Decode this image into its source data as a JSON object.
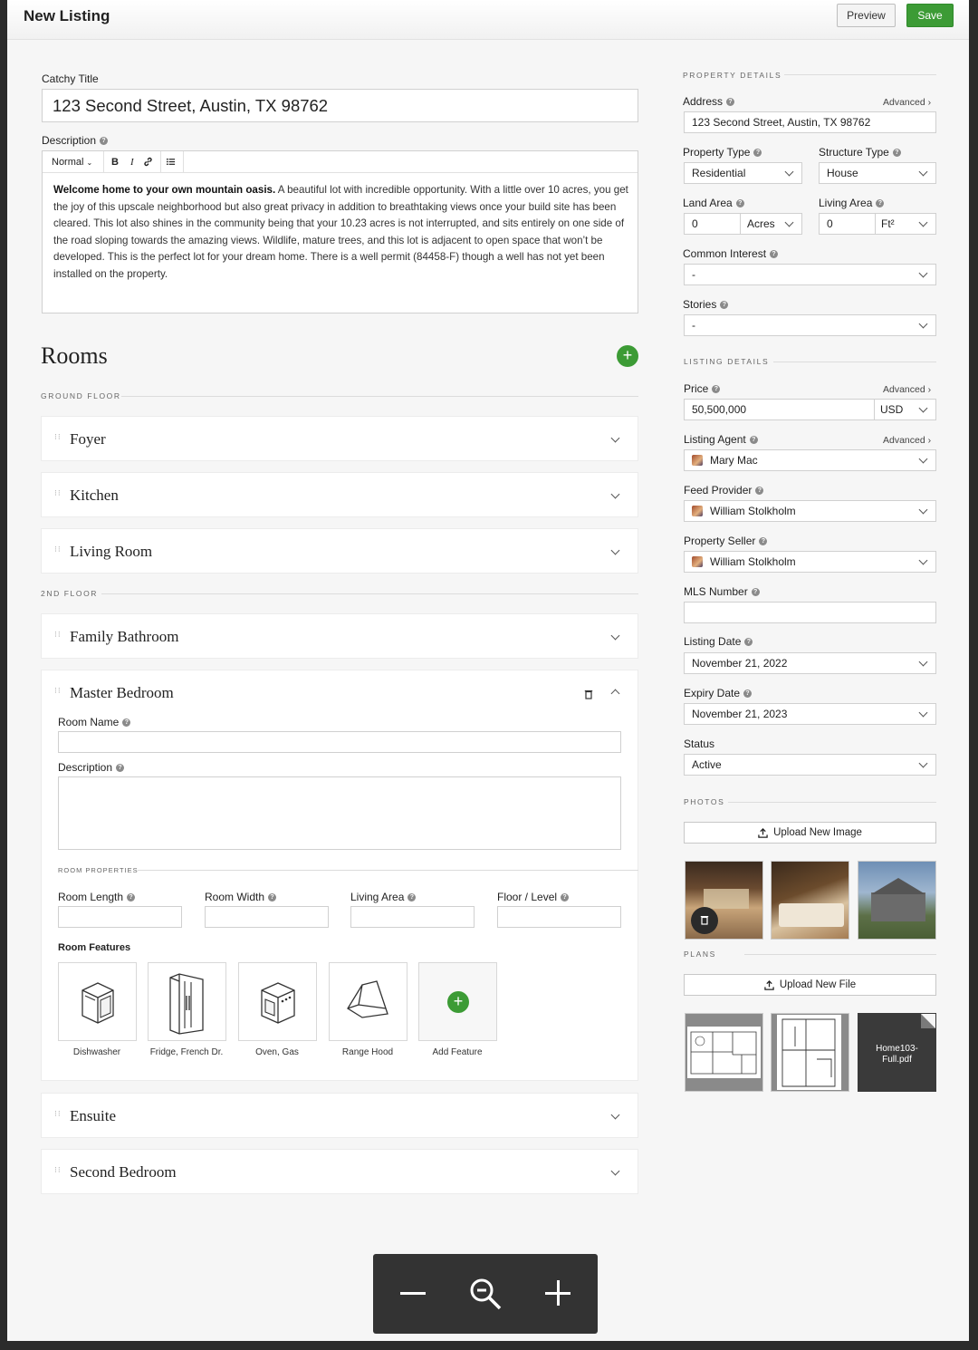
{
  "header": {
    "title": "New Listing",
    "preview_label": "Preview",
    "save_label": "Save"
  },
  "form": {
    "title_label": "Catchy Title",
    "title_value": "123 Second Street, Austin, TX 98762",
    "description_label": "Description",
    "toolbar": {
      "format": "Normal",
      "bold": "B",
      "italic": "I"
    },
    "description_bold": "Welcome home to your own mountain oasis.",
    "description_body": " A beautiful lot with incredible opportunity.   With a little over 10 acres, you get the joy of this upscale neighborhood but also great privacy in addition to breathtaking views once your build site has been cleared. This lot also shines in the community being that your 10.23 acres is not interrupted, and sits entirely on one side of the road sloping towards the amazing views. Wildlife, mature trees, and this lot is adjacent to open space that won’t be developed. This is the perfect lot for your dream home.  There is a well permit (84458-F) though a well has not yet been installed on the property."
  },
  "rooms": {
    "title": "Rooms",
    "ground_floor_caption": "GROUND FLOOR",
    "second_floor_caption": "2ND FLOOR",
    "items": [
      "Foyer",
      "Kitchen",
      "Living Room",
      "Family Bathroom",
      "Master Bedroom",
      "Ensuite",
      "Second Bedroom"
    ],
    "expanded": {
      "room_name_label": "Room Name",
      "description_label": "Description",
      "properties_caption": "ROOM PROPERTIES",
      "room_length_label": "Room Length",
      "room_width_label": "Room Width",
      "living_area_label": "Living Area",
      "floor_level_label": "Floor / Level",
      "features_label": "Room Features",
      "features": [
        "Dishwasher",
        "Fridge, French Dr.",
        "Oven, Gas",
        "Range Hood",
        "Add Feature"
      ]
    }
  },
  "property": {
    "caption": "PROPERTY DETAILS",
    "address_label": "Address",
    "advanced": "Advanced ›",
    "address_value": "123 Second Street, Austin, TX 98762",
    "property_type_label": "Property Type",
    "property_type_value": "Residential",
    "structure_type_label": "Structure Type",
    "structure_type_value": "House",
    "land_area_label": "Land Area",
    "land_area_value": "0",
    "land_area_unit": "Acres",
    "living_area_label": "Living Area",
    "living_area_value": "0",
    "living_area_unit": "Ft²",
    "common_interest_label": "Common Interest",
    "common_interest_value": "-",
    "stories_label": "Stories",
    "stories_value": "-"
  },
  "listing": {
    "caption": "LISTING DETAILS",
    "price_label": "Price",
    "price_value": "50,500,000",
    "currency": "USD",
    "agent_label": "Listing Agent",
    "agent_value": "Mary Mac",
    "feed_label": "Feed Provider",
    "feed_value": "William Stolkholm",
    "seller_label": "Property Seller",
    "seller_value": "William Stolkholm",
    "mls_label": "MLS Number",
    "mls_value": "",
    "listing_date_label": "Listing Date",
    "listing_date_value": "November 21, 2022",
    "expiry_date_label": "Expiry Date",
    "expiry_date_value": "November 21, 2023",
    "status_label": "Status",
    "status_value": "Active"
  },
  "photos": {
    "caption": "PHOTOS",
    "upload_label": "Upload New Image"
  },
  "plans": {
    "caption": "PLANS",
    "upload_label": "Upload New File",
    "pdf_name": "Home103-Full.pdf"
  },
  "colors": {
    "accent": "#3c9b35",
    "background": "#f6f6f6"
  }
}
